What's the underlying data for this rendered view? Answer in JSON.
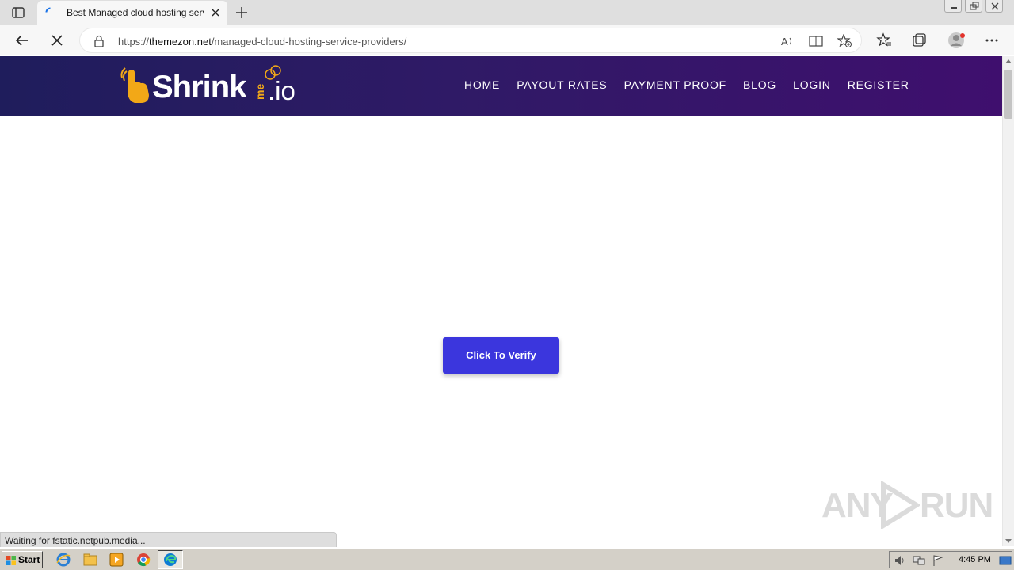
{
  "browser": {
    "tab_title": "Best Managed cloud hosting service providers",
    "url_scheme_prefix": "https://",
    "url_host": "themezon.net",
    "url_path": "/managed-cloud-hosting-service-providers/"
  },
  "site": {
    "logo_word": "Shrink",
    "logo_me": "me",
    "logo_io": ".io",
    "nav": [
      "HOME",
      "PAYOUT RATES",
      "PAYMENT PROOF",
      "BLOG",
      "LOGIN",
      "REGISTER"
    ],
    "verify_label": "Click To Verify",
    "accent_color": "#3b36dd",
    "logo_accent_color": "#f2a817"
  },
  "status_bar": {
    "text": "Waiting for fstatic.netpub.media..."
  },
  "watermark": {
    "left": "ANY",
    "right": "RUN"
  },
  "taskbar": {
    "start_label": "Start",
    "clock": "4:45 PM",
    "apps": [
      "ie-icon",
      "explorer-icon",
      "media-player-icon",
      "chrome-icon",
      "edge-icon"
    ]
  }
}
